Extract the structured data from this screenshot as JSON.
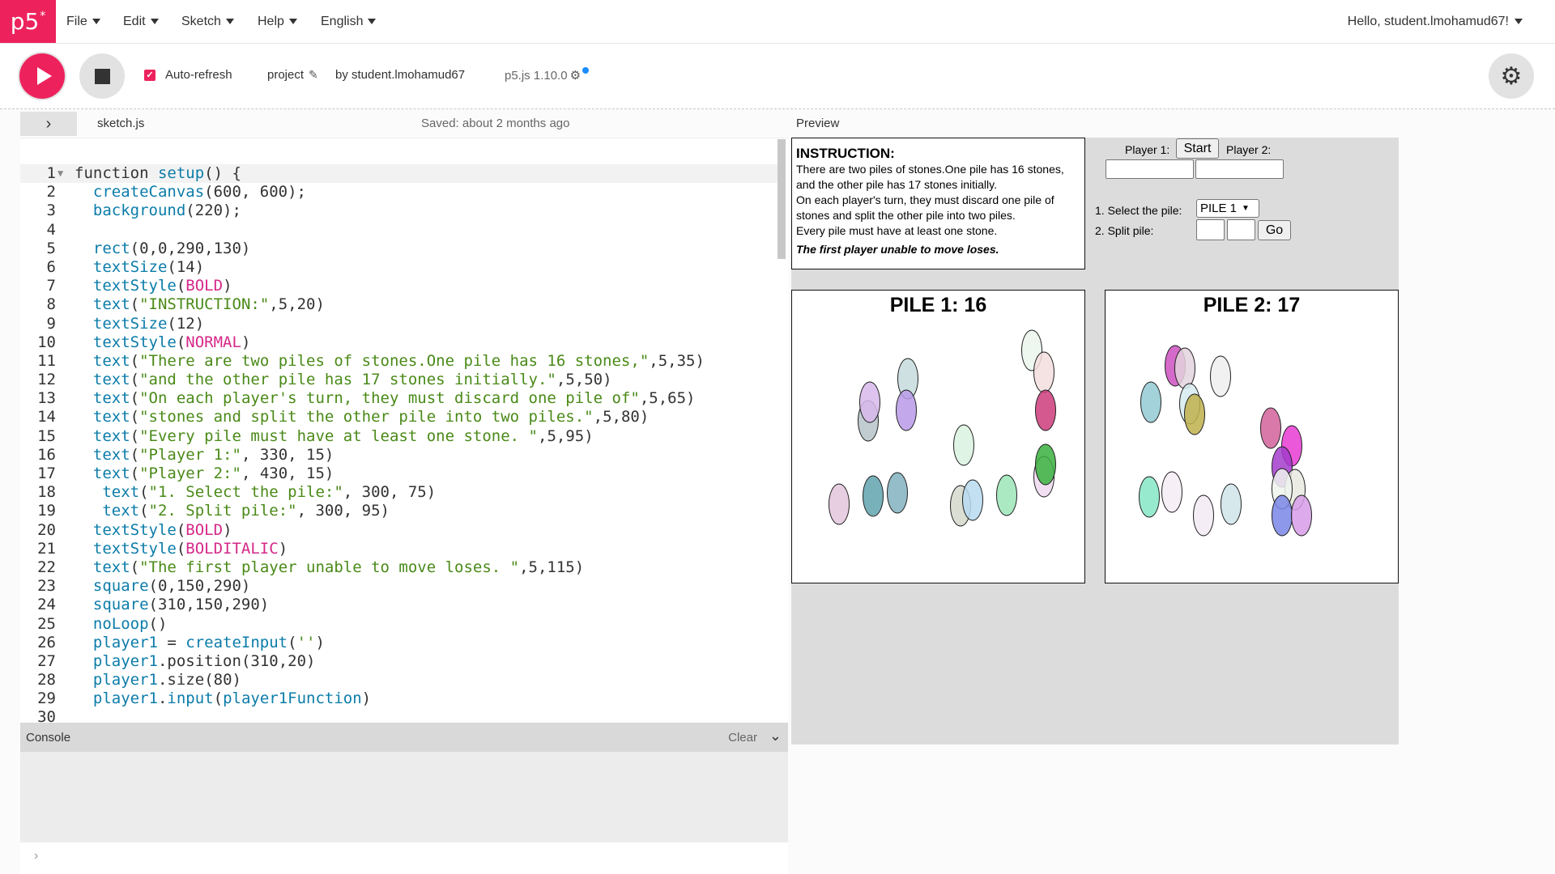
{
  "app": {
    "logo_text": "p5",
    "logo_mark": "*",
    "menu": [
      {
        "label": "File"
      },
      {
        "label": "Edit"
      },
      {
        "label": "Sketch"
      },
      {
        "label": "Help"
      },
      {
        "label": "English"
      }
    ],
    "greeting": "Hello, student.lmohamud67!"
  },
  "toolbar": {
    "auto_refresh_label": "Auto-refresh",
    "auto_refresh_checked": true,
    "project_name": "project",
    "byline": "by student.lmohamud67",
    "version": "p5.js 1.10.0",
    "play_icon": "play-icon",
    "stop_icon": "stop-icon",
    "settings_icon": "gear-icon"
  },
  "editor": {
    "filename": "sketch.js",
    "saved_status": "Saved: about 2 months ago",
    "lines": [
      "function setup() {",
      "  createCanvas(600, 600);",
      "  background(220);",
      "",
      "  rect(0,0,290,130)",
      "  textSize(14)",
      "  textStyle(BOLD)",
      "  text(\"INSTRUCTION:\",5,20)",
      "  textSize(12)",
      "  textStyle(NORMAL)",
      "  text(\"There are two piles of stones.One pile has 16 stones,\",5,35)",
      "  text(\"and the other pile has 17 stones initially.\",5,50)",
      "  text(\"On each player's turn, they must discard one pile of\",5,65)",
      "  text(\"stones and split the other pile into two piles.\",5,80)",
      "  text(\"Every pile must have at least one stone. \",5,95)",
      "  text(\"Player 1:\", 330, 15)",
      "  text(\"Player 2:\", 430, 15)",
      "   text(\"1. Select the pile:\", 300, 75)",
      "   text(\"2. Split pile:\", 300, 95)",
      "  textStyle(BOLD)",
      "  textStyle(BOLDITALIC)",
      "  text(\"The first player unable to move loses. \",5,115)",
      "  square(0,150,290)",
      "  square(310,150,290)",
      "  noLoop()",
      "  player1 = createInput('')",
      "  player1.position(310,20)",
      "  player1.size(80)",
      "  player1.input(player1Function)",
      ""
    ]
  },
  "console": {
    "title": "Console",
    "clear_label": "Clear",
    "prompt": "›"
  },
  "preview": {
    "label": "Preview",
    "instruction": {
      "title": "INSTRUCTION:",
      "lines": [
        "There are two piles of stones.One pile has 16 stones,",
        "and the other pile has 17 stones initially.",
        "On each player's turn, they must discard one pile of",
        "stones and split the other pile into two piles.",
        "Every pile must have at least one stone."
      ],
      "rule": "The first player unable to move loses."
    },
    "controls": {
      "player1_label": "Player 1:",
      "start_button": "Start",
      "player2_label": "Player 2:",
      "player1_value": "",
      "player2_value": "",
      "select_label": "1. Select the pile:",
      "select_value": "PILE 1",
      "split_label": "2. Split pile:",
      "split_a": "",
      "split_b": "",
      "go_button": "Go"
    },
    "pile1_title": "PILE 1: 16",
    "pile2_title": "PILE 2: 17"
  }
}
